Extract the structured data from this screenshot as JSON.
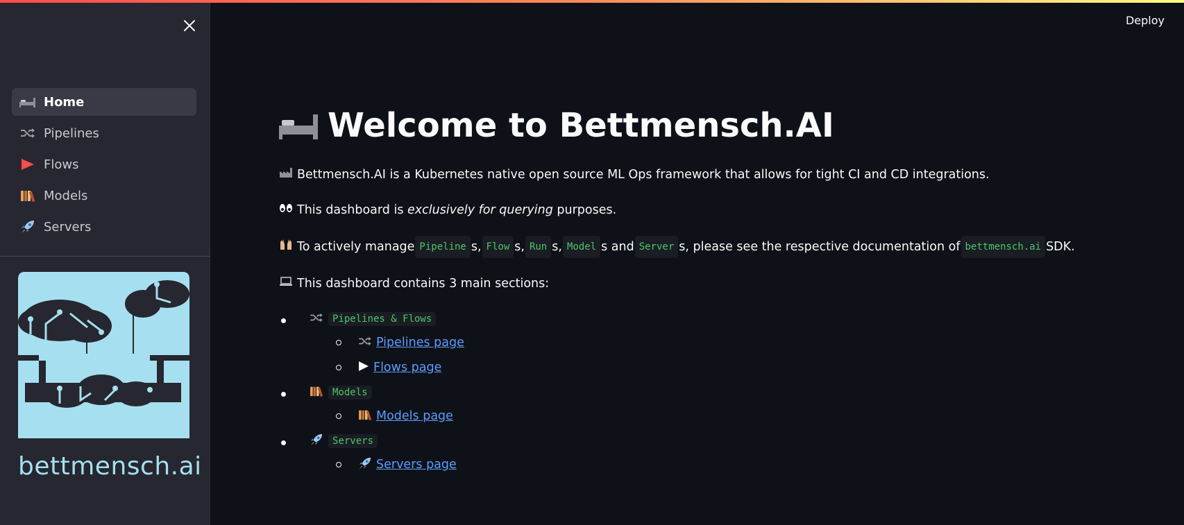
{
  "header": {
    "deploy_label": "Deploy"
  },
  "sidebar": {
    "items": [
      {
        "label": "Home",
        "icon": "bed-icon",
        "active": true
      },
      {
        "label": "Pipelines",
        "icon": "shuffle-icon",
        "active": false
      },
      {
        "label": "Flows",
        "icon": "play-triangle-icon",
        "active": false
      },
      {
        "label": "Models",
        "icon": "books-icon",
        "active": false
      },
      {
        "label": "Servers",
        "icon": "rocket-icon",
        "active": false
      }
    ],
    "logo_text": "bettmensch.ai"
  },
  "main": {
    "title": "Welcome to Bettmensch.AI",
    "intro": "Bettmensch.AI is a Kubernetes native open source ML Ops framework that allows for tight CI and CD integrations.",
    "query_prefix": "This dashboard is ",
    "query_em": "exclusively for querying",
    "query_suffix": " purposes.",
    "manage": {
      "prefix": "To actively manage ",
      "codes": [
        "Pipeline",
        "Flow",
        "Run",
        "Model",
        "Server"
      ],
      "sep_s_comma": "s, ",
      "sep_s_and": "s and ",
      "suffix_mid": "s, please see the respective documentation of ",
      "sdk_code": "bettmensch.ai",
      "suffix_end": " SDK."
    },
    "sections_intro": "This dashboard contains 3 main sections:",
    "sections": [
      {
        "code": "Pipelines & Flows",
        "links": [
          "Pipelines page",
          "Flows page"
        ]
      },
      {
        "code": "Models",
        "links": [
          "Models page"
        ]
      },
      {
        "code": "Servers",
        "links": [
          "Servers page"
        ]
      }
    ]
  },
  "colors": {
    "accent": "#ff4b4b",
    "code_text": "#4bc66a",
    "link": "#5c9dff",
    "logo": "#a6dff0"
  }
}
